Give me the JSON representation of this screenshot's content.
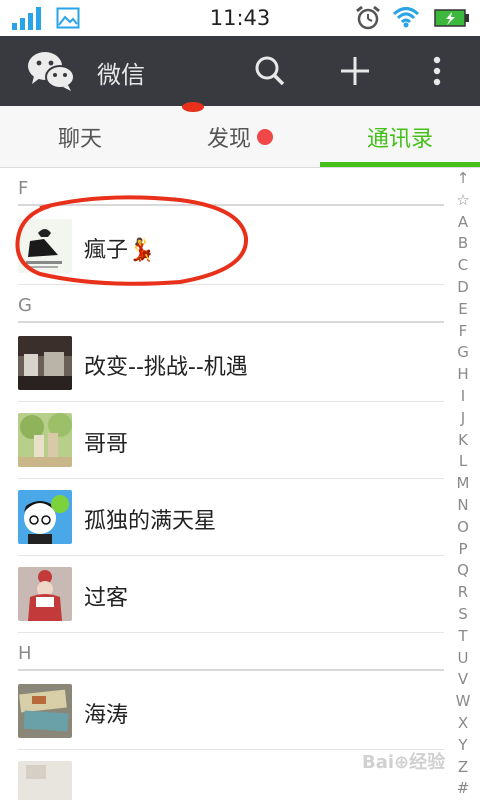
{
  "status_bar": {
    "time": "11:43"
  },
  "app_bar": {
    "title": "微信"
  },
  "tabs": [
    {
      "label": "聊天"
    },
    {
      "label": "发现"
    },
    {
      "label": "通讯录"
    }
  ],
  "sections": [
    {
      "letter": "F",
      "contacts": [
        {
          "name": "瘋子💃"
        }
      ]
    },
    {
      "letter": "G",
      "contacts": [
        {
          "name": "改变--挑战--机遇"
        },
        {
          "name": "哥哥"
        },
        {
          "name": "孤独的满天星"
        },
        {
          "name": "过客"
        }
      ]
    },
    {
      "letter": "H",
      "contacts": [
        {
          "name": "海涛"
        }
      ]
    }
  ],
  "index_letters": [
    "↑",
    "☆",
    "A",
    "B",
    "C",
    "D",
    "E",
    "F",
    "G",
    "H",
    "I",
    "J",
    "K",
    "L",
    "M",
    "N",
    "O",
    "P",
    "Q",
    "R",
    "S",
    "T",
    "U",
    "V",
    "W",
    "X",
    "Y",
    "Z",
    "#"
  ],
  "colors": {
    "accent": "#45c01a",
    "app_bar": "#393a3f",
    "badge": "#f04848",
    "annotation": "#e8301a"
  },
  "icons": [
    "signal-icon",
    "image-icon",
    "alarm-icon",
    "wifi-icon",
    "battery-icon",
    "wechat-logo-icon",
    "search-icon",
    "plus-icon",
    "more-icon"
  ]
}
